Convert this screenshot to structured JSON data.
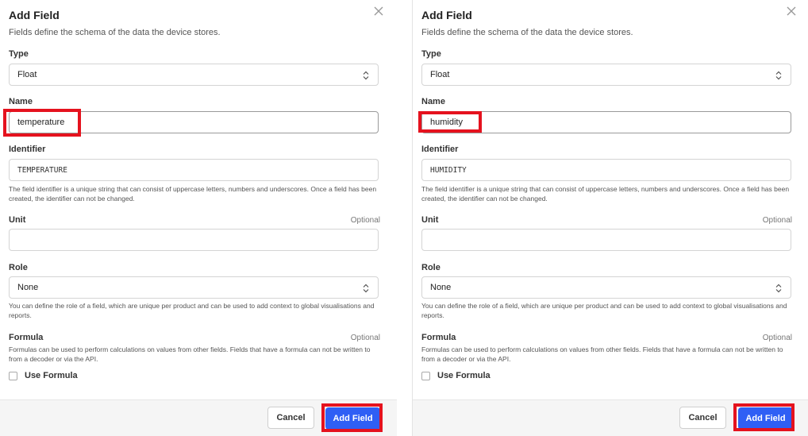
{
  "dialogs": [
    {
      "title": "Add Field",
      "subtitle": "Fields define the schema of the data the device stores.",
      "close_icon": "close-icon",
      "type": {
        "label": "Type",
        "value": "Float"
      },
      "name": {
        "label": "Name",
        "value": "temperature"
      },
      "identifier": {
        "label": "Identifier",
        "value": "TEMPERATURE",
        "help": "The field identifier is a unique string that can consist of uppercase letters, numbers and underscores. Once a field has been created, the identifier can not be changed."
      },
      "unit": {
        "label": "Unit",
        "optional": "Optional",
        "value": ""
      },
      "role": {
        "label": "Role",
        "value": "None",
        "help": "You can define the role of a field, which are unique per product and can be used to add context to global visualisations and reports."
      },
      "formula": {
        "label": "Formula",
        "optional": "Optional",
        "help": "Formulas can be used to perform calculations on values from other fields. Fields that have a formula can not be written to from a decoder or via the API.",
        "checkbox_label": "Use Formula",
        "checked": false
      },
      "footer": {
        "cancel_label": "Cancel",
        "submit_label": "Add Field"
      }
    },
    {
      "title": "Add Field",
      "subtitle": "Fields define the schema of the data the device stores.",
      "close_icon": "close-icon",
      "type": {
        "label": "Type",
        "value": "Float"
      },
      "name": {
        "label": "Name",
        "value": "humidity"
      },
      "identifier": {
        "label": "Identifier",
        "value": "HUMIDITY",
        "help": "The field identifier is a unique string that can consist of uppercase letters, numbers and underscores. Once a field has been created, the identifier can not be changed."
      },
      "unit": {
        "label": "Unit",
        "optional": "Optional",
        "value": ""
      },
      "role": {
        "label": "Role",
        "value": "None",
        "help": "You can define the role of a field, which are unique per product and can be used to add context to global visualisations and reports."
      },
      "formula": {
        "label": "Formula",
        "optional": "Optional",
        "help": "Formulas can be used to perform calculations on values from other fields. Fields that have a formula can not be written to from a decoder or via the API.",
        "checkbox_label": "Use Formula",
        "checked": false
      },
      "footer": {
        "cancel_label": "Cancel",
        "submit_label": "Add Field"
      }
    }
  ],
  "colors": {
    "primary": "#2f5ff5",
    "highlight": "#e5121e"
  }
}
